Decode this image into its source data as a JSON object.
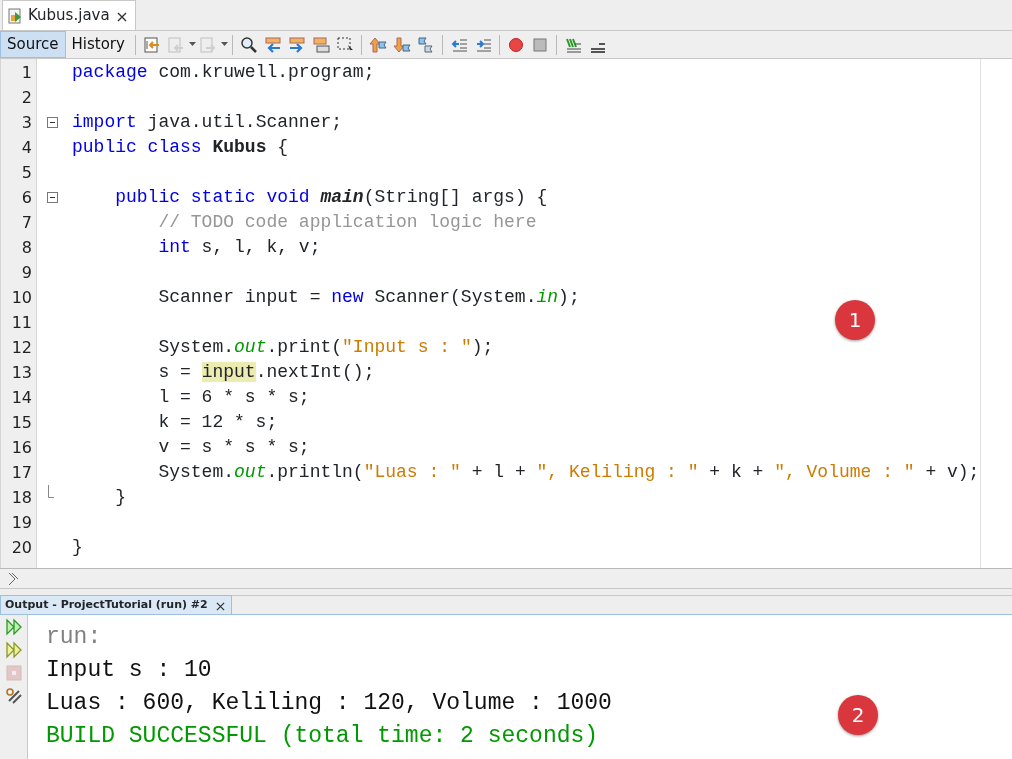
{
  "file_tab": {
    "title": "Kubus.java",
    "selected": true
  },
  "view_tabs": [
    {
      "label": "Source",
      "selected": true
    },
    {
      "label": "History",
      "selected": false
    }
  ],
  "toolbar": [
    {
      "disabled": false
    },
    {
      "disabled": true
    },
    {
      "disabled": true
    },
    {
      "disabled": false
    },
    {
      "disabled": false
    },
    {
      "disabled": false
    },
    {
      "disabled": false
    },
    {
      "disabled": false
    },
    {
      "disabled": false
    },
    {
      "disabled": false
    },
    {
      "disabled": false
    },
    {
      "disabled": false
    },
    {
      "disabled": false
    },
    {
      "disabled": false
    },
    {
      "disabled": false
    },
    {
      "disabled": false
    },
    {
      "disabled": false
    }
  ],
  "editor": {
    "lines": [
      {
        "number": "1",
        "tokens": [
          {
            "kind": "keyword",
            "text": "package"
          },
          {
            "kind": "plain",
            "text": " com.kruwell.program;"
          }
        ]
      },
      {
        "number": "2"
      },
      {
        "number": "3",
        "foldable": true,
        "tokens": [
          {
            "kind": "keyword",
            "text": "import"
          },
          {
            "kind": "plain",
            "text": " java.util.Scanner;"
          }
        ]
      },
      {
        "number": "4",
        "tokens": [
          {
            "kind": "keyword",
            "text": "public class"
          },
          {
            "kind": "bold",
            "text": " Kubus"
          },
          {
            "kind": "plain",
            "text": " {"
          }
        ]
      },
      {
        "number": "5"
      },
      {
        "number": "6",
        "foldable": true,
        "tokens": [
          {
            "kind": "keyword",
            "text": "public static void"
          },
          {
            "kind": "method",
            "text": " main"
          },
          {
            "kind": "plain",
            "text": "(String[] args) {"
          }
        ]
      },
      {
        "number": "7",
        "tokens": [
          {
            "kind": "comment",
            "text": "// TODO code application logic here"
          }
        ]
      },
      {
        "number": "8",
        "tokens": [
          {
            "kind": "keyword",
            "text": "int"
          },
          {
            "kind": "plain",
            "text": " s, l, k, v;"
          }
        ]
      },
      {
        "number": "9"
      },
      {
        "number": "10",
        "tokens": [
          {
            "kind": "plain",
            "text": "Scanner input = "
          },
          {
            "kind": "keyword",
            "text": "new"
          },
          {
            "kind": "plain",
            "text": " Scanner(System."
          },
          {
            "kind": "field",
            "text": "in"
          },
          {
            "kind": "plain",
            "text": ");"
          }
        ]
      },
      {
        "number": "11"
      },
      {
        "number": "12",
        "tokens": [
          {
            "kind": "plain",
            "text": "System."
          },
          {
            "kind": "field",
            "text": "out"
          },
          {
            "kind": "plain",
            "text": ".print("
          },
          {
            "kind": "string",
            "text": "\"Input s : \""
          },
          {
            "kind": "plain",
            "text": ");"
          }
        ]
      },
      {
        "number": "13",
        "tokens": [
          {
            "kind": "plain",
            "text": "s = "
          },
          {
            "kind": "highlight",
            "text": "input"
          },
          {
            "kind": "plain",
            "text": ".nextInt();"
          }
        ]
      },
      {
        "number": "14",
        "tokens": [
          {
            "kind": "plain",
            "text": "l = 6 * s * s;"
          }
        ]
      },
      {
        "number": "15",
        "tokens": [
          {
            "kind": "plain",
            "text": "k = 12 * s;"
          }
        ]
      },
      {
        "number": "16",
        "tokens": [
          {
            "kind": "plain",
            "text": "v = s * s * s;"
          }
        ]
      },
      {
        "number": "17",
        "tokens": [
          {
            "kind": "plain",
            "text": "System."
          },
          {
            "kind": "field",
            "text": "out"
          },
          {
            "kind": "plain",
            "text": ".println("
          },
          {
            "kind": "string",
            "text": "\"Luas : \""
          },
          {
            "kind": "plain",
            "text": " + l + "
          },
          {
            "kind": "string",
            "text": "\", Keliling : \""
          },
          {
            "kind": "plain",
            "text": " + k + "
          },
          {
            "kind": "string",
            "text": "\", Volume : \""
          },
          {
            "kind": "plain",
            "text": " + v);"
          }
        ]
      },
      {
        "number": "18",
        "fold_end": true,
        "tokens": [
          {
            "kind": "plain",
            "text": "}"
          }
        ]
      },
      {
        "number": "19"
      },
      {
        "number": "20",
        "tokens": [
          {
            "kind": "plain",
            "text": "}"
          }
        ]
      }
    ]
  },
  "output": {
    "tab_title": "Output - ProjectTutorial (run) #2",
    "side_buttons": [
      {
        "disabled": false
      },
      {
        "disabled": false
      },
      {
        "disabled": true
      },
      {
        "disabled": false
      }
    ],
    "lines": [
      {
        "kind": "info",
        "text": "run:"
      },
      {
        "kind": "plain",
        "text": "Input s : 10"
      },
      {
        "kind": "plain",
        "text": "Luas : 600, Keliling : 120, Volume : 1000"
      },
      {
        "kind": "success",
        "text": "BUILD SUCCESSFUL (total time: 2 seconds)"
      }
    ]
  },
  "annotations": [
    {
      "text": "1"
    },
    {
      "text": "2"
    }
  ]
}
